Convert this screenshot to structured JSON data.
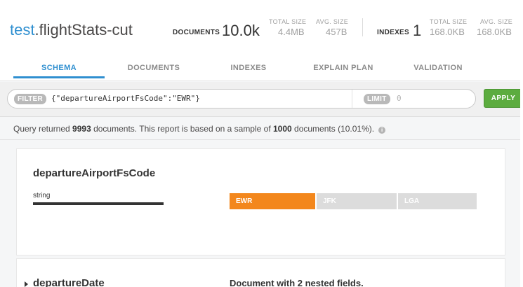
{
  "namespace": {
    "database": "test",
    "separator": ".",
    "collection": "flightStats-cut"
  },
  "stats": {
    "documents_label": "DOCUMENTS",
    "documents_value": "10.0k",
    "total_size_label": "TOTAL SIZE",
    "total_size_value": "4.4MB",
    "avg_size_label": "AVG. SIZE",
    "avg_size_value": "457B",
    "indexes_label": "INDEXES",
    "indexes_value": "1",
    "idx_total_size_label": "TOTAL SIZE",
    "idx_total_size_value": "168.0KB",
    "idx_avg_size_label": "AVG. SIZE",
    "idx_avg_size_value": "168.0KB"
  },
  "tabs": [
    {
      "label": "SCHEMA",
      "active": true
    },
    {
      "label": "DOCUMENTS",
      "active": false
    },
    {
      "label": "INDEXES",
      "active": false
    },
    {
      "label": "EXPLAIN PLAN",
      "active": false
    },
    {
      "label": "VALIDATION",
      "active": false
    }
  ],
  "querybar": {
    "filter_label": "FILTER",
    "filter_value": "{\"departureAirportFsCode\":\"EWR\"}",
    "limit_label": "LIMIT",
    "limit_placeholder": "0",
    "apply_label": "APPLY"
  },
  "status": {
    "prefix": "Query returned ",
    "returned": "9993",
    "middle": " documents. This report is based on a sample of ",
    "sample": "1000",
    "suffix": " documents (10.01%).",
    "info_icon": "i"
  },
  "fields": [
    {
      "name": "departureAirportFsCode",
      "type": "string",
      "values": [
        {
          "label": "EWR",
          "color": "#f3871c"
        },
        {
          "label": "JFK",
          "color": "#dcdcdc"
        },
        {
          "label": "LGA",
          "color": "#dcdcdc"
        }
      ]
    },
    {
      "name": "departureDate",
      "summary": "Document with 2 nested fields."
    }
  ],
  "colors": {
    "accent": "#2f8fd0",
    "apply": "#5cac3f",
    "highlight": "#f3871c"
  }
}
